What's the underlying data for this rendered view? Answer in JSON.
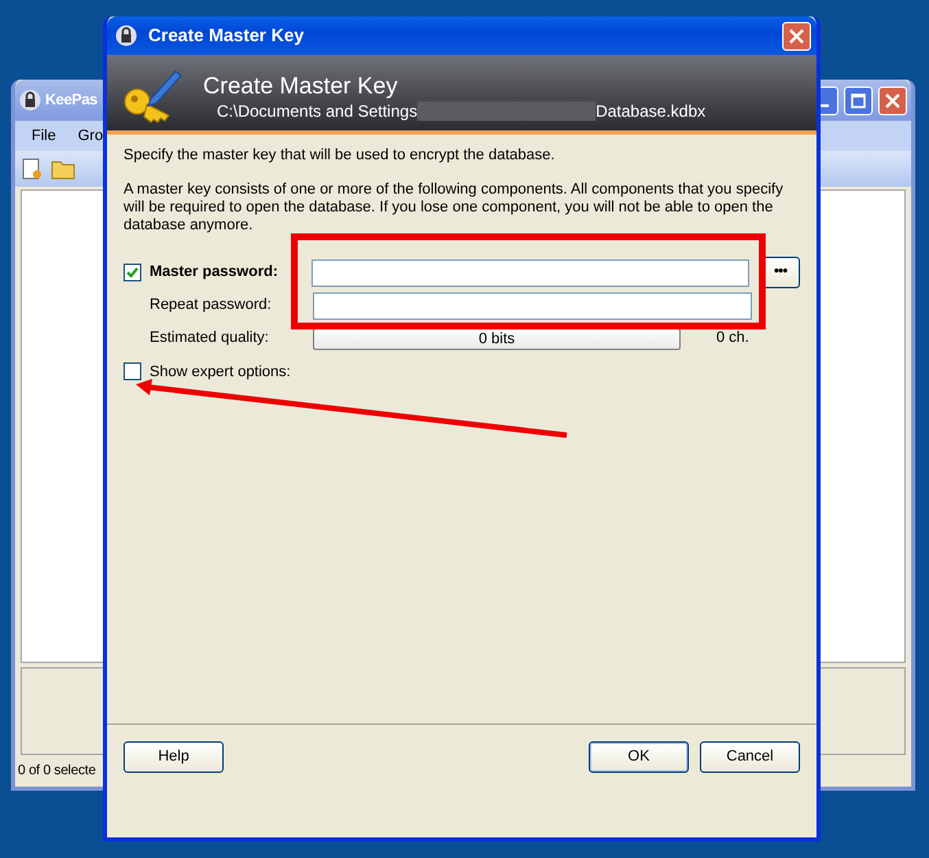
{
  "background_window": {
    "title": "KeePas",
    "menu": [
      "File",
      "Gro"
    ],
    "status": "0 of 0 selecte"
  },
  "dialog": {
    "title": "Create Master Key",
    "banner_title": "Create Master Key",
    "path_start": "C:\\Documents and Settings",
    "path_end": "Database.kdbx",
    "intro": "Specify the master key that will be used to encrypt the database.",
    "description": "A master key consists of one or more of the following components. All components that you specify will be required to open the database. If you lose one component, you will not be able to open the database anymore.",
    "master_password": {
      "label": "Master password:",
      "checked": true
    },
    "reveal_button": "●●●",
    "repeat_label": "Repeat password:",
    "quality_label": "Estimated quality:",
    "quality_reading": "0 bits",
    "char_count": "0 ch.",
    "expert_options": {
      "label": "Show expert options:",
      "checked": false
    },
    "buttons": [
      {
        "label": "Help",
        "default": false
      },
      {
        "label": "OK",
        "default": true
      },
      {
        "label": "Cancel",
        "default": false
      }
    ]
  }
}
